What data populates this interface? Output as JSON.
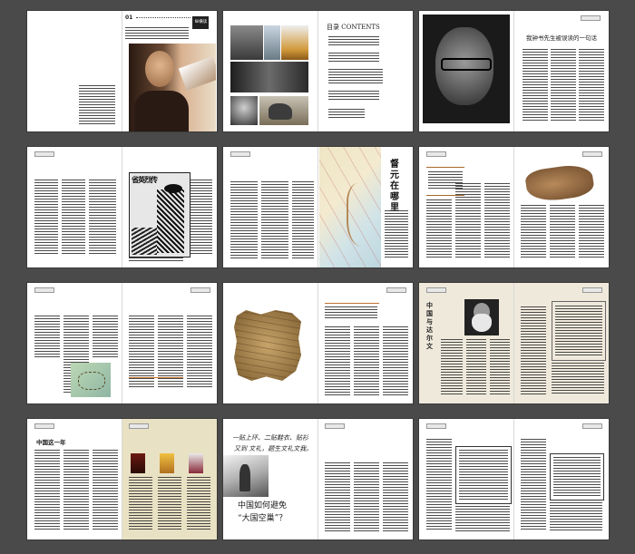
{
  "spreads": [
    {
      "id": "opening",
      "page_number": "01",
      "banner": "纵横读"
    },
    {
      "id": "contents",
      "contents_heading": "目录 CONTENTS"
    },
    {
      "id": "portrait",
      "headline": "我钟书先生被误读的一句话"
    },
    {
      "id": "woodcut",
      "poster_text": "省英烈传"
    },
    {
      "id": "map",
      "vertical_title": "督元在哪里"
    },
    {
      "id": "artifact"
    },
    {
      "id": "map-small"
    },
    {
      "id": "parchment"
    },
    {
      "id": "darwin",
      "vertical_title": "中国与达尔文"
    },
    {
      "id": "china-year",
      "heading": "中国这一年"
    },
    {
      "id": "calligraphy",
      "calligraphy_line1": "一贴上环、二贴鞋衣、贴衫",
      "calligraphy_line2": "又到 文礼，题生文礼文我。",
      "headline_line1": "中国如何避免",
      "headline_line2": "“大国空巢”？"
    },
    {
      "id": "columns"
    }
  ],
  "colors": {
    "background": "#4a4a4a",
    "page": "#ffffff",
    "beige": "#efe9dc",
    "tan": "#e9e1c4",
    "map_sea": "#cfe3e8",
    "map_land": "#efe6c4",
    "parchment": "#b08a50"
  }
}
